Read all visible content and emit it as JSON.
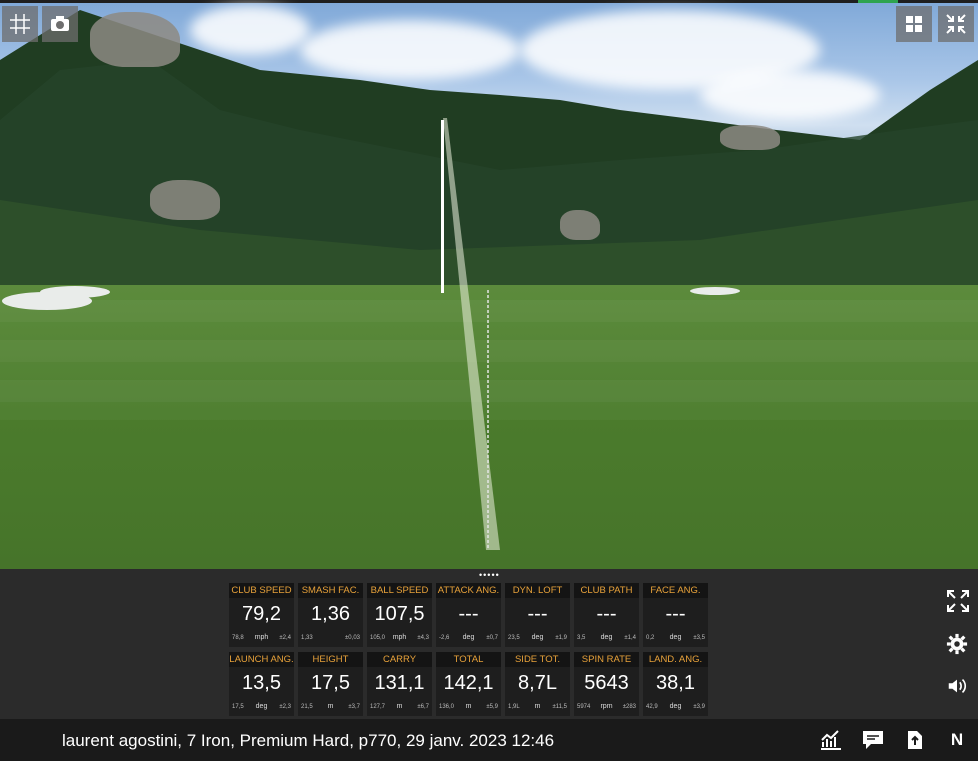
{
  "scene": {
    "toolbar": {
      "grid_icon": "grid-icon",
      "camera_icon": "camera-icon",
      "layout_icon": "layout-icon",
      "collapse_icon": "collapse-icon"
    }
  },
  "metrics": {
    "row1": [
      {
        "label": "CLUB SPEED",
        "value": "79,2",
        "mean": "78,8",
        "unit": "mph",
        "sd": "±2,4"
      },
      {
        "label": "SMASH FAC.",
        "value": "1,36",
        "mean": "1,33",
        "unit": "",
        "sd": "±0,03"
      },
      {
        "label": "BALL SPEED",
        "value": "107,5",
        "mean": "105,0",
        "unit": "mph",
        "sd": "±4,3"
      },
      {
        "label": "ATTACK ANG.",
        "value": "---",
        "mean": "-2,6",
        "unit": "deg",
        "sd": "±0,7"
      },
      {
        "label": "DYN. LOFT",
        "value": "---",
        "mean": "23,5",
        "unit": "deg",
        "sd": "±1,9"
      },
      {
        "label": "CLUB PATH",
        "value": "---",
        "mean": "3,5",
        "unit": "deg",
        "sd": "±1,4"
      },
      {
        "label": "FACE ANG.",
        "value": "---",
        "mean": "0,2",
        "unit": "deg",
        "sd": "±3,5"
      }
    ],
    "row2": [
      {
        "label": "LAUNCH ANG.",
        "value": "13,5",
        "mean": "17,5",
        "unit": "deg",
        "sd": "±2,3"
      },
      {
        "label": "HEIGHT",
        "value": "17,5",
        "mean": "21,5",
        "unit": "m",
        "sd": "±3,7"
      },
      {
        "label": "CARRY",
        "value": "131,1",
        "mean": "127,7",
        "unit": "m",
        "sd": "±6,7"
      },
      {
        "label": "TOTAL",
        "value": "142,1",
        "mean": "136,0",
        "unit": "m",
        "sd": "±5,9"
      },
      {
        "label": "SIDE TOT.",
        "value": "8,7L",
        "mean": "1,9L",
        "unit": "m",
        "sd": "±11,5"
      },
      {
        "label": "SPIN RATE",
        "value": "5643",
        "mean": "5974",
        "unit": "rpm",
        "sd": "±283"
      },
      {
        "label": "LAND. ANG.",
        "value": "38,1",
        "mean": "42,9",
        "unit": "deg",
        "sd": "±3,9"
      }
    ]
  },
  "side_controls": {
    "expand_icon": "expand-icon",
    "settings_icon": "gear-icon",
    "sound_icon": "speaker-icon"
  },
  "footer": {
    "info": "laurent agostini, 7 Iron, Premium Hard, p770, 29 janv. 2023 12:46",
    "n_label": "N"
  }
}
